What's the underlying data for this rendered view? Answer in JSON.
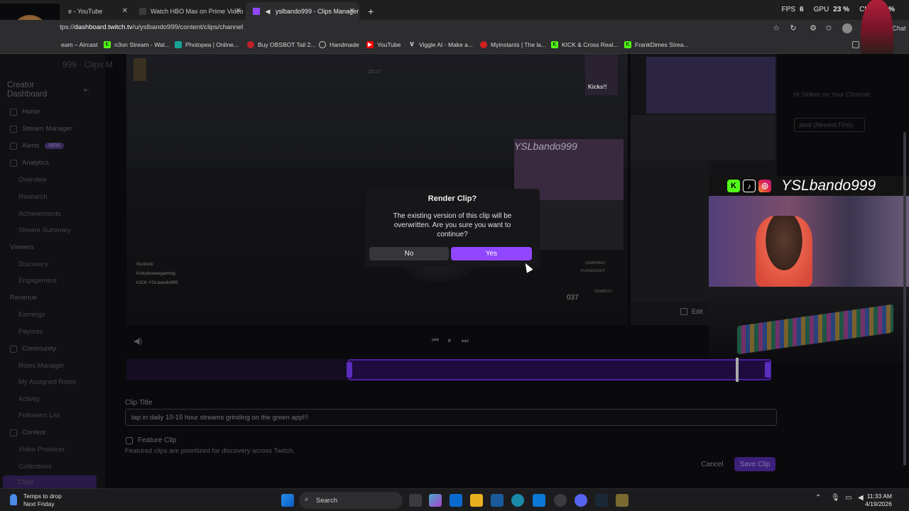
{
  "browser": {
    "tabs": [
      {
        "label": "e - YouTube",
        "active": false
      },
      {
        "label": "Watch HBO Max on Prime Video",
        "active": false
      },
      {
        "label": "yslbando999 - Clips Manager",
        "active": true
      }
    ],
    "new_tab": "+",
    "stats": {
      "fps_label": "FPS",
      "fps": "6",
      "gpu_label": "GPU",
      "gpu": "23 %",
      "cpu_label": "CPU",
      "cpu": "16 %"
    },
    "url_prefix": "tps://",
    "url_host": "dashboard.twitch.tv",
    "url_path": "/u/yslbando999/content/clips/channel",
    "chat_label": "Chat",
    "bookmarks": [
      {
        "label": "eam – Aircast",
        "icon_color": "#e8e8e8"
      },
      {
        "label": "n3on Stream - Wat...",
        "icon_color": "#53fc18"
      },
      {
        "label": "Photopea | Online...",
        "icon_color": "#18a497"
      },
      {
        "label": "Buy OBSBOT Tail 2...",
        "icon_color": "#c0202a"
      },
      {
        "label": "Handmade",
        "icon_color": "#cccccc"
      },
      {
        "label": "YouTube",
        "icon_color": "#ff0000"
      },
      {
        "label": "Viggle AI - Make a...",
        "icon_color": "#ffffff"
      },
      {
        "label": "Myinstants | The la...",
        "icon_color": "#d02020"
      },
      {
        "label": "KICK & Cross Real...",
        "icon_color": "#53fc18"
      },
      {
        "label": "FrankDimes Strea...",
        "icon_color": "#53fc18"
      }
    ]
  },
  "sidebar": {
    "page_title_fragment": "999 - Clips M",
    "header": "Creator Dashboard",
    "items": [
      {
        "label": "Home",
        "sub": false
      },
      {
        "label": "Stream Manager",
        "sub": false
      },
      {
        "label": "Alerts",
        "sub": false,
        "badge": "NEW"
      },
      {
        "label": "Analytics",
        "sub": false
      },
      {
        "label": "Overview",
        "sub": true
      },
      {
        "label": "Research",
        "sub": true
      },
      {
        "label": "Achievements",
        "sub": true
      },
      {
        "label": "Stream Summary",
        "sub": true
      },
      {
        "label": "Viewers",
        "sub": false
      },
      {
        "label": "Discovery",
        "sub": true
      },
      {
        "label": "Engagement",
        "sub": true
      },
      {
        "label": "Revenue",
        "sub": false
      },
      {
        "label": "Earnings",
        "sub": true
      },
      {
        "label": "Payouts",
        "sub": true
      },
      {
        "label": "Community",
        "sub": false
      },
      {
        "label": "Roles Manager",
        "sub": true
      },
      {
        "label": "My Assigned Roles",
        "sub": true
      },
      {
        "label": "Activity",
        "sub": true
      },
      {
        "label": "Followers List",
        "sub": true
      },
      {
        "label": "Content",
        "sub": false
      },
      {
        "label": "Video Producer",
        "sub": true
      },
      {
        "label": "Collections",
        "sub": true
      },
      {
        "label": "Clips",
        "sub": true
      }
    ]
  },
  "video": {
    "overlay_name": "YSLbando999",
    "timestamp": "23:17",
    "hud_left": [
      "Gunlock",
      "Kickybooeegaming",
      "KICK-YSLbando999"
    ],
    "hud_right": [
      "UNARMED",
      "FLASHLIGHT",
      "TEMPEST",
      "037"
    ],
    "caption_top": "Kicks!!"
  },
  "right_panel": {
    "strikes_text": "ht Strikes on Your Channel",
    "sort_label": "ated (Newest First)",
    "edit_label": "Edit"
  },
  "webcam": {
    "name": "YSLbando999"
  },
  "editor": {
    "clip_title_label": "Clip Title",
    "clip_title_value": "tap in daily 10-15 hour streams grinding on the green app!!!",
    "feature_label": "Feature Clip",
    "feature_help": "Featured clips are prioritized for discovery across Twitch.",
    "cancel_label": "Cancel",
    "save_label": "Save Clip"
  },
  "modal": {
    "title": "Render Clip?",
    "body": "The existing version of this clip will be overwritten. Are you sure you want to continue?",
    "no_label": "No",
    "yes_label": "Yes"
  },
  "taskbar": {
    "weather_line1": "Temps to drop",
    "weather_line2": "Next Friday",
    "search_placeholder": "Search",
    "time": "11:33 AM",
    "date": "4/19/2026"
  },
  "colors": {
    "accent": "#9147ff",
    "kick_green": "#53fc18"
  }
}
